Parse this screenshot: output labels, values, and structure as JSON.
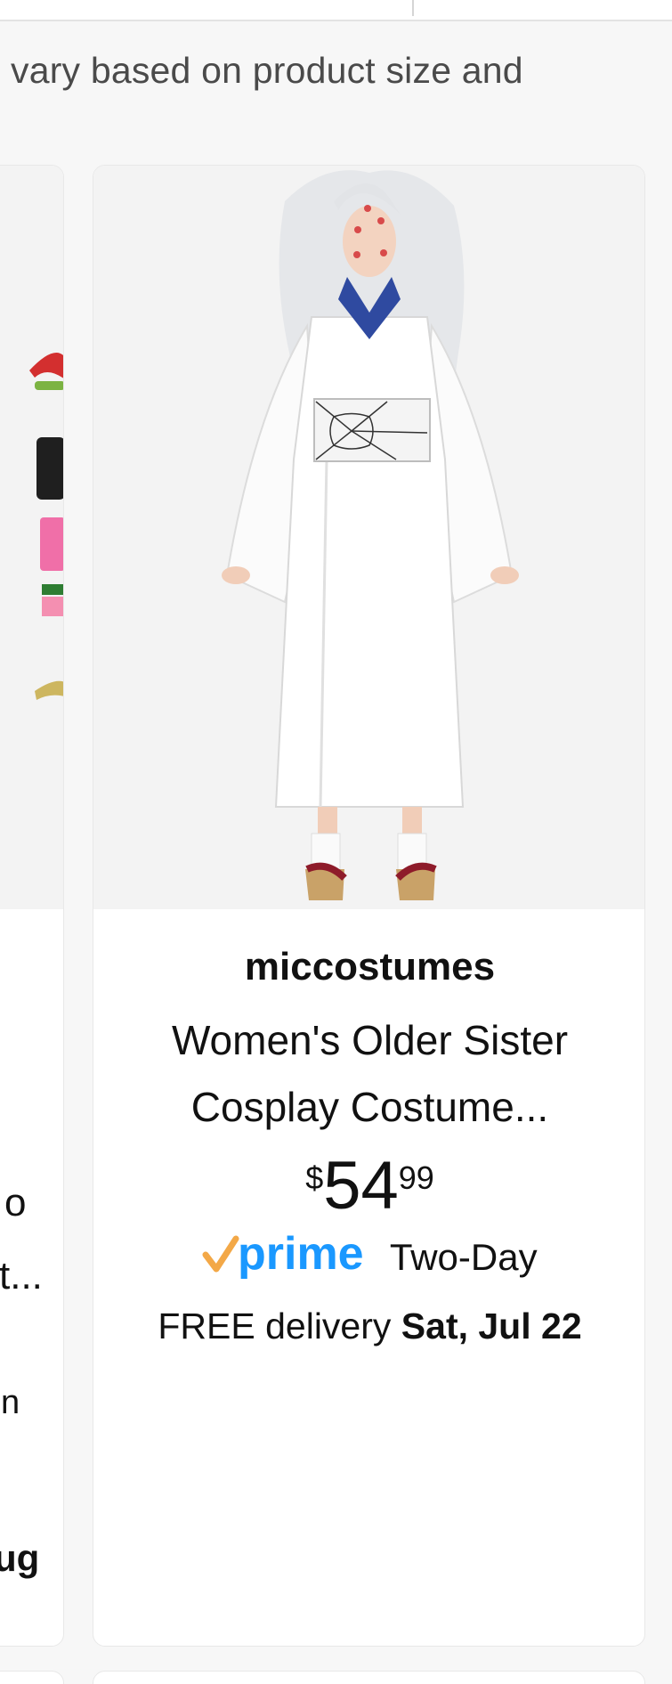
{
  "header": {
    "notice_text": "vary based on product size and"
  },
  "left_card": {
    "fragments": [
      "o",
      "t...",
      "n",
      "ug"
    ]
  },
  "product": {
    "brand": "miccostumes",
    "title_line1": "Women's Older Sister",
    "title_line2": "Cosplay Costume...",
    "price_symbol": "$",
    "price_whole": "54",
    "price_fraction": "99",
    "prime_label": "prime",
    "shipping_speed": "Two-Day",
    "delivery_prefix": "FREE delivery",
    "delivery_date": "Sat, Jul 22",
    "image_icon": "costume-photo-icon"
  },
  "colors": {
    "prime_blue": "#1a98ff",
    "prime_check": "#f3a847",
    "text": "#111111",
    "muted_text": "#4a4a4a"
  }
}
